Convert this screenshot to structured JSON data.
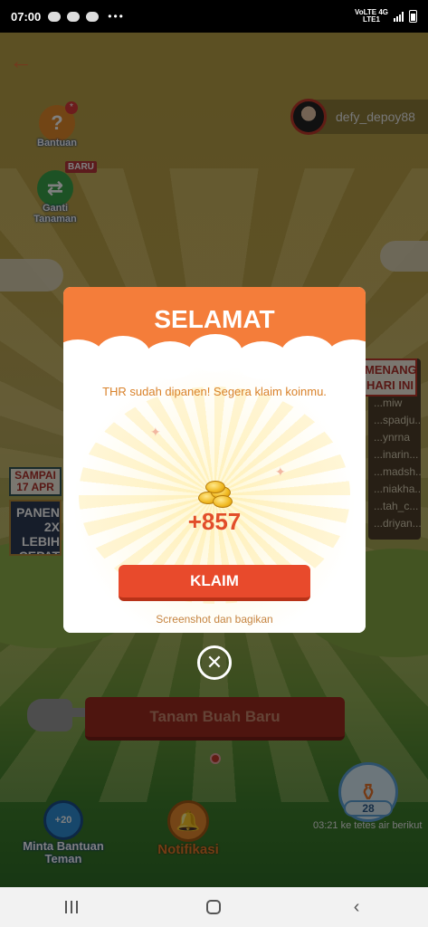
{
  "status_bar": {
    "time": "07:00",
    "network_top": "VoLTE 4G",
    "network_bottom": "LTE1"
  },
  "header": {
    "username": "defy_depoy88"
  },
  "side_buttons": {
    "help_label": "Bantuan",
    "help_badge": "*",
    "change_plant_label": "Ganti Tanaman",
    "new_badge": "BARU"
  },
  "background": {
    "leaderboard_title": "MENANG HARI INI",
    "leaderboard_names": [
      "...miw",
      "...spadju...",
      "...ynrna",
      "...inarin...",
      "...madsh...",
      "...niakha...",
      "...tah_c...",
      "...driyan..."
    ],
    "promo_date": "SAMPAI 17 APR",
    "promo_text": "PANEN 2X LEBIH CEPAT"
  },
  "modal": {
    "title": "SELAMAT",
    "message": "THR sudah dipanen! Segera klaim koinmu.",
    "amount": "+857",
    "claim_label": "KLAIM",
    "share_label": "Screenshot dan bagikan",
    "close_icon": "close-icon"
  },
  "main_action": {
    "label": "Tanam Buah Baru"
  },
  "bottom_bar": {
    "ask_help_badge": "+20",
    "ask_help_label": "Minta Bantuan Teman",
    "notification_label": "Notifikasi",
    "water_count": "28",
    "water_timer": "03:21 ke tetes air berikut"
  },
  "colors": {
    "accent_orange": "#f47d3a",
    "claim_red": "#e84a2c",
    "amount_red": "#e24e2a",
    "message_orange": "#d9822b"
  }
}
